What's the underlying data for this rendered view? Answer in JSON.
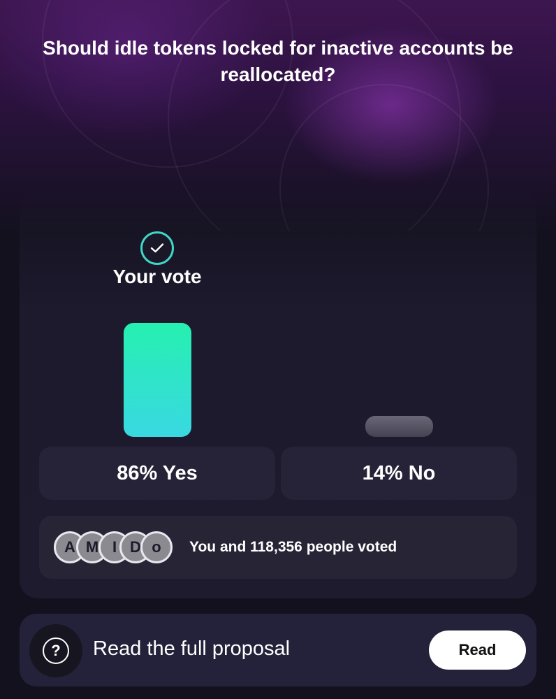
{
  "poll": {
    "question": "Should idle tokens locked for inactive accounts be reallocated?",
    "your_vote_label": "Your vote",
    "options": [
      {
        "label": "86% Yes",
        "percent": 86,
        "selected": true,
        "color": "#2ee6c4"
      },
      {
        "label": "14% No",
        "percent": 14,
        "selected": false,
        "color": "#5a5868"
      }
    ]
  },
  "voters": {
    "avatars": [
      "A",
      "M",
      "I",
      "D",
      "o"
    ],
    "summary": "You and 118,356 people voted"
  },
  "proposal": {
    "text": "Read the full proposal",
    "button_label": "Read",
    "icon": "question-icon"
  },
  "colors": {
    "accent": "#3fd6c6",
    "background": "#14111f"
  }
}
